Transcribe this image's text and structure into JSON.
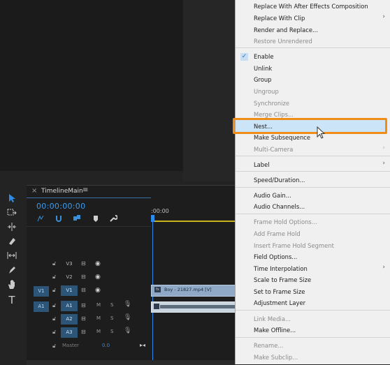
{
  "timeline": {
    "tab_close": "×",
    "title": "TimelineMain",
    "tab_menu": "≡",
    "timecode": "00:00:00:00",
    "ruler_start": ":00:00",
    "tracks": [
      {
        "patch": "",
        "name": "V3",
        "type": "video"
      },
      {
        "patch": "",
        "name": "V2",
        "type": "video"
      },
      {
        "patch": "V1",
        "name": "V1",
        "type": "video"
      },
      {
        "patch": "A1",
        "name": "A1",
        "type": "audio"
      },
      {
        "patch": "",
        "name": "A2",
        "type": "audio"
      },
      {
        "patch": "",
        "name": "A3",
        "type": "audio"
      }
    ],
    "mute_label": "M",
    "solo_label": "S",
    "video_clip": "Boy - 21827.mp4 [V]",
    "video_clip_fx": "fx",
    "master_label": "Master",
    "master_value": "0.0"
  },
  "menu": {
    "items": [
      {
        "label": "Replace With After Effects Composition",
        "disabled": false
      },
      {
        "label": "Replace With Clip",
        "disabled": false,
        "submenu": true
      },
      {
        "label": "Render and Replace...",
        "disabled": false
      },
      {
        "label": "Restore Unrendered",
        "disabled": true
      },
      {
        "label": "Enable",
        "disabled": false,
        "checked": true
      },
      {
        "label": "Unlink",
        "disabled": false
      },
      {
        "label": "Group",
        "disabled": false
      },
      {
        "label": "Ungroup",
        "disabled": true
      },
      {
        "label": "Synchronize",
        "disabled": true
      },
      {
        "label": "Merge Clips...",
        "disabled": true
      },
      {
        "label": "Nest...",
        "disabled": false,
        "highlighted": true
      },
      {
        "label": "Make Subsequence",
        "disabled": false
      },
      {
        "label": "Multi-Camera",
        "disabled": true,
        "submenu": true
      },
      {
        "label": "Label",
        "disabled": false,
        "submenu": true
      },
      {
        "label": "Speed/Duration...",
        "disabled": false
      },
      {
        "label": "Audio Gain...",
        "disabled": false
      },
      {
        "label": "Audio Channels...",
        "disabled": false
      },
      {
        "label": "Frame Hold Options...",
        "disabled": true
      },
      {
        "label": "Add Frame Hold",
        "disabled": true
      },
      {
        "label": "Insert Frame Hold Segment",
        "disabled": true
      },
      {
        "label": "Field Options...",
        "disabled": false
      },
      {
        "label": "Time Interpolation",
        "disabled": false,
        "submenu": true
      },
      {
        "label": "Scale to Frame Size",
        "disabled": false
      },
      {
        "label": "Set to Frame Size",
        "disabled": false
      },
      {
        "label": "Adjustment Layer",
        "disabled": false
      },
      {
        "label": "Link Media...",
        "disabled": true
      },
      {
        "label": "Make Offline...",
        "disabled": false
      },
      {
        "label": "Rename...",
        "disabled": true
      },
      {
        "label": "Make Subclip...",
        "disabled": true
      }
    ],
    "check_mark": "✓",
    "submenu_arrow": "›"
  },
  "colors": {
    "highlight_outline": "#f08c18",
    "selection": "#cce4f7",
    "timecode": "#3b9cf0",
    "accent": "#2d8ceb"
  },
  "icons": {
    "tools": [
      "selection-arrow-icon",
      "track-select-icon",
      "ripple-edit-icon",
      "razor-icon",
      "slip-icon",
      "pen-icon",
      "hand-icon",
      "type-icon"
    ]
  }
}
